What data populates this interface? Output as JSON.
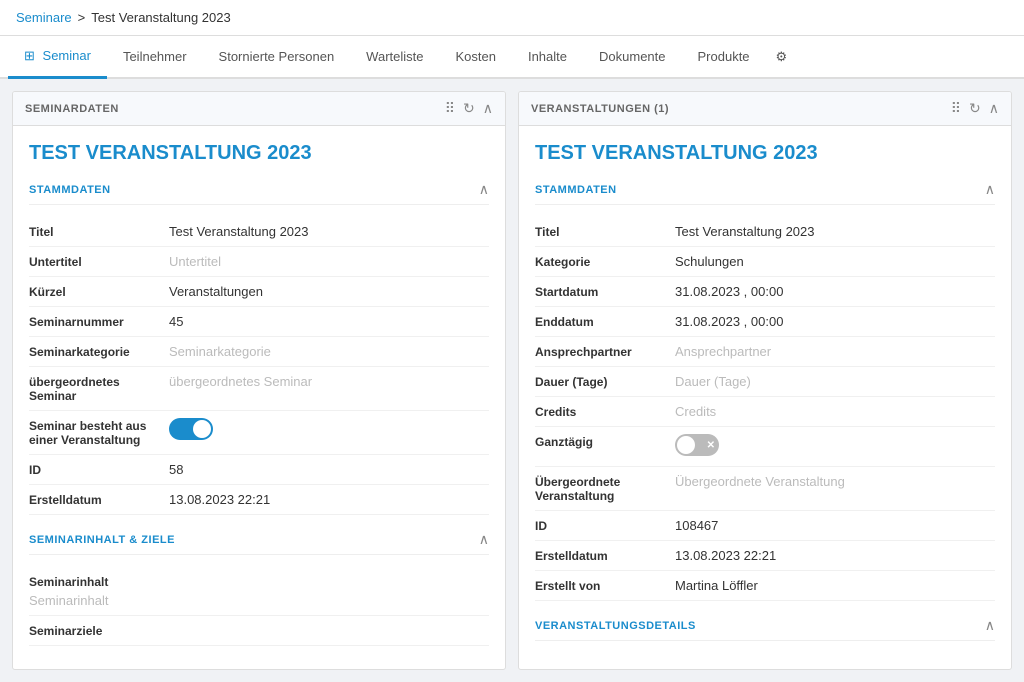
{
  "breadcrumb": {
    "link_label": "Seminare",
    "separator": ">",
    "current": "Test Veranstaltung 2023"
  },
  "tabs": [
    {
      "id": "seminar",
      "label": "Seminar",
      "active": true,
      "icon": true
    },
    {
      "id": "teilnehmer",
      "label": "Teilnehmer",
      "active": false
    },
    {
      "id": "stornierte",
      "label": "Stornierte Personen",
      "active": false
    },
    {
      "id": "warteliste",
      "label": "Warteliste",
      "active": false
    },
    {
      "id": "kosten",
      "label": "Kosten",
      "active": false
    },
    {
      "id": "inhalte",
      "label": "Inhalte",
      "active": false
    },
    {
      "id": "dokumente",
      "label": "Dokumente",
      "active": false
    },
    {
      "id": "produkte",
      "label": "Produkte",
      "active": false
    }
  ],
  "left_panel": {
    "header": "SEMINARDATEN",
    "main_title": "TEST VERANSTALTUNG 2023",
    "stammdaten_title": "STAMMDATEN",
    "fields": [
      {
        "label": "Titel",
        "value": "Test Veranstaltung 2023",
        "placeholder": false
      },
      {
        "label": "Untertitel",
        "value": "Untertitel",
        "placeholder": true
      },
      {
        "label": "Kürzel",
        "value": "Veranstaltungen",
        "placeholder": false
      },
      {
        "label": "Seminarnummer",
        "value": "45",
        "placeholder": false
      },
      {
        "label": "Seminarkategorie",
        "value": "Seminarkategorie",
        "placeholder": true
      },
      {
        "label": "übergeordnetes Seminar",
        "value": "übergeordnetes Seminar",
        "placeholder": true
      },
      {
        "label": "Seminar besteht aus einer Veranstaltung",
        "value": "toggle_on",
        "placeholder": false
      },
      {
        "label": "ID",
        "value": "58",
        "placeholder": false
      },
      {
        "label": "Erstelldatum",
        "value": "13.08.2023 22:21",
        "placeholder": false
      }
    ],
    "seminarinhalt_title": "SEMINARINHALT & ZIELE",
    "content_fields": [
      {
        "label": "Seminarinhalt",
        "value": "Seminarinhalt",
        "placeholder": true
      },
      {
        "label": "Seminarziele",
        "value": "",
        "placeholder": true
      }
    ]
  },
  "right_panel": {
    "header": "VERANSTALTUNGEN (1)",
    "main_title": "TEST VERANSTALTUNG 2023",
    "stammdaten_title": "STAMMDATEN",
    "fields": [
      {
        "label": "Titel",
        "value": "Test Veranstaltung 2023",
        "placeholder": false
      },
      {
        "label": "Kategorie",
        "value": "Schulungen",
        "placeholder": false
      },
      {
        "label": "Startdatum",
        "value": "31.08.2023 ,  00:00",
        "placeholder": false
      },
      {
        "label": "Enddatum",
        "value": "31.08.2023 ,  00:00",
        "placeholder": false
      },
      {
        "label": "Ansprechpartner",
        "value": "Ansprechpartner",
        "placeholder": true
      },
      {
        "label": "Dauer (Tage)",
        "value": "Dauer (Tage)",
        "placeholder": true
      },
      {
        "label": "Credits",
        "value": "Credits",
        "placeholder": true
      },
      {
        "label": "Ganztägig",
        "value": "toggle_off",
        "placeholder": false
      },
      {
        "label": "Übergeordnete Veranstaltung",
        "value": "Übergeordnete Veranstaltung",
        "placeholder": true
      },
      {
        "label": "ID",
        "value": "108467",
        "placeholder": false
      },
      {
        "label": "Erstelldatum",
        "value": "13.08.2023 22:21",
        "placeholder": false
      },
      {
        "label": "Erstellt von",
        "value": "Martina Löffler",
        "placeholder": false
      }
    ],
    "veranstaltungsdetails_title": "VERANSTALTUNGSDETAILS"
  }
}
